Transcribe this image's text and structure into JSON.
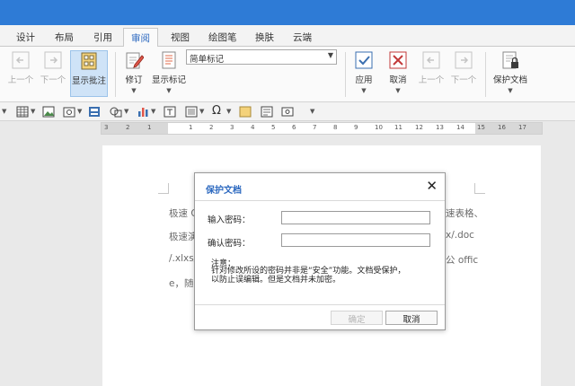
{
  "tabs": [
    "设计",
    "布局",
    "引用",
    "审阅",
    "视图",
    "绘图笔",
    "换肤",
    "云端"
  ],
  "active_tab": "审阅",
  "ribbon": {
    "prev_label": "上一个",
    "next_label": "下一个",
    "show_comments_label": "显示批注",
    "revise_label": "修订",
    "show_markup_label": "显示标记",
    "markup_combo_value": "简单标记",
    "accept_label": "应用",
    "reject_label": "取消",
    "prev_change_label": "上一个",
    "next_change_label": "下一个",
    "protect_label": "保护文档"
  },
  "ruler": {
    "numbers": [
      "3",
      "2",
      "1",
      "1",
      "2",
      "3",
      "4",
      "5",
      "6",
      "7",
      "8",
      "9",
      "10",
      "11",
      "12",
      "13",
      "14",
      "15",
      "16",
      "17"
    ]
  },
  "document": {
    "lines": [
      {
        "left": "极速 O",
        "right": "速表格、"
      },
      {
        "left": "极速演",
        "right": "x/.doc"
      },
      {
        "left": "/.xlxs/",
        "right": "公 offic"
      },
      {
        "left": "e，随",
        "right": ""
      }
    ]
  },
  "dialog": {
    "title": "保护文档",
    "close_glyph": "✕",
    "password_label": "输入密码：",
    "confirm_label": "确认密码：",
    "password_value": "",
    "confirm_value": "",
    "note_title": "注意：",
    "note_line1": "针对修改所设的密码并非是“安全”功能。文档受保护，",
    "note_line2": "以防止误编辑。但是文档并未加密。",
    "ok_label": "确定",
    "cancel_label": "取消"
  },
  "colors": {
    "titlebar": "#2e7bd6",
    "accent": "#2e6ac0"
  },
  "icons": [
    "prev-arrow-icon",
    "next-arrow-icon",
    "show-comments-icon",
    "revise-pen-icon",
    "show-markup-icon",
    "accept-check-icon",
    "reject-x-icon",
    "protect-document-icon",
    "table-icon",
    "image-icon",
    "screenshot-icon",
    "shapes-icon",
    "chart-icon",
    "textbox-icon",
    "symbol-omega-icon",
    "sticky-note-icon",
    "font-style-icon",
    "link-icon"
  ]
}
